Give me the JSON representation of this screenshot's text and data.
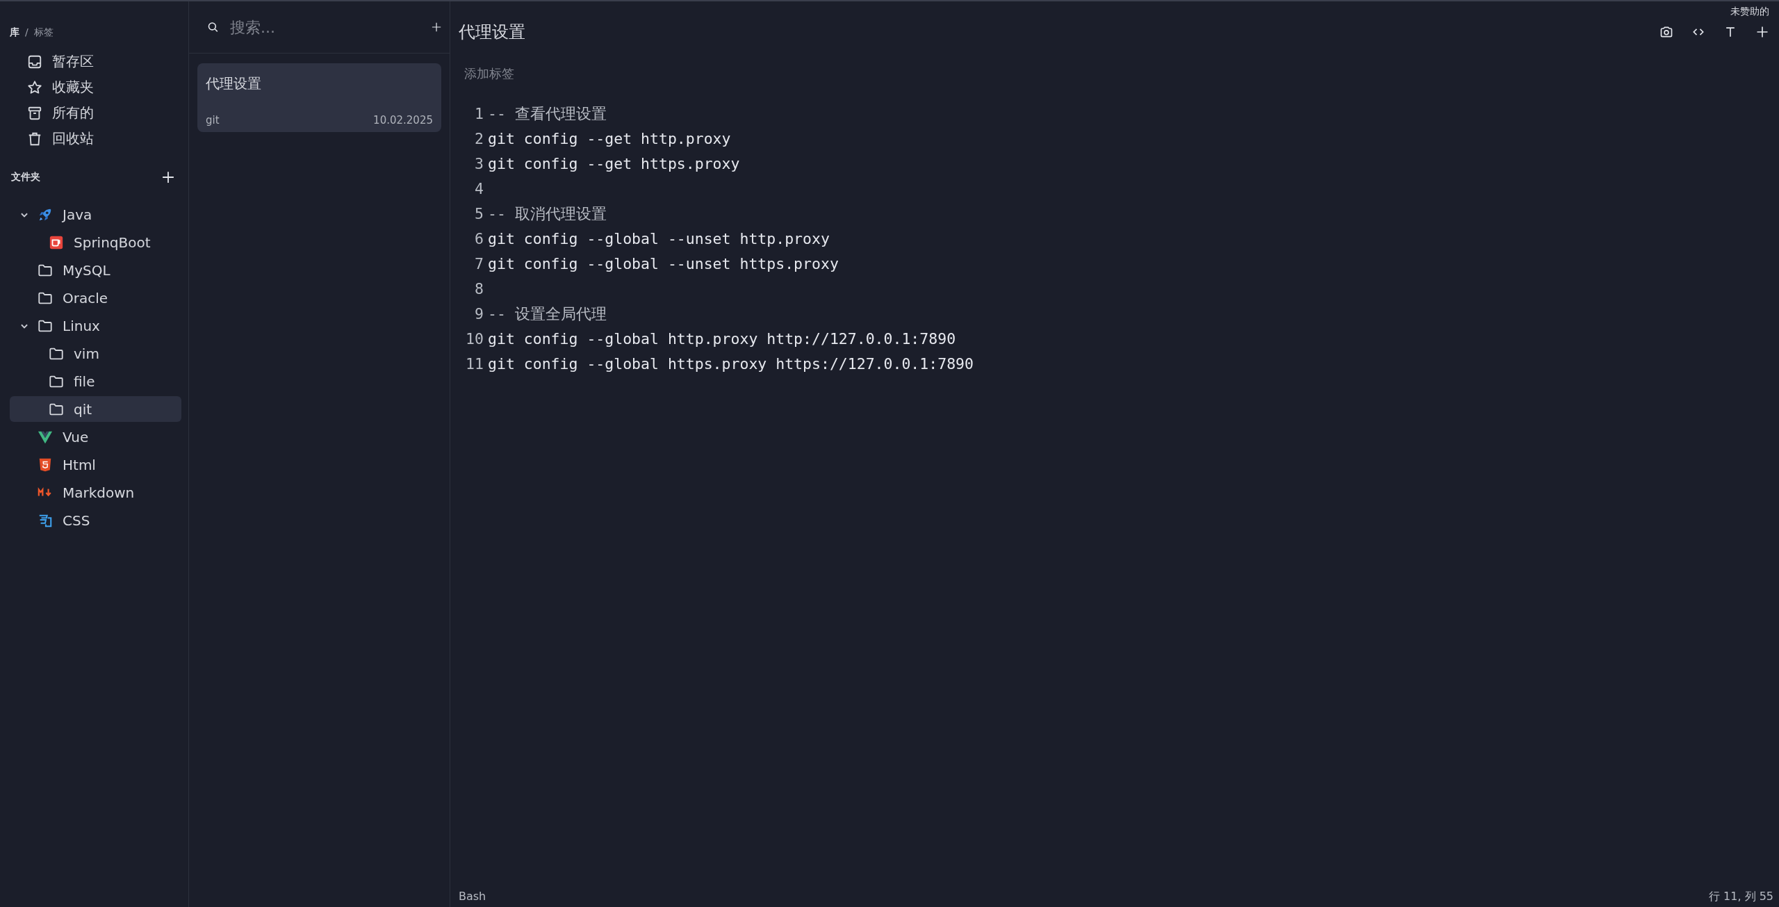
{
  "breadcrumb": {
    "library": "库",
    "separator": "/",
    "tags": "标签"
  },
  "library_items": [
    {
      "label": "暂存区",
      "kind": "inbox"
    },
    {
      "label": "收藏夹",
      "kind": "star"
    },
    {
      "label": "所有的",
      "kind": "archive"
    },
    {
      "label": "回收站",
      "kind": "trash"
    }
  ],
  "folders_heading": "文件夹",
  "folders": [
    {
      "label": "Java",
      "kind": "rocket",
      "expanded": true,
      "selected": false,
      "children": [
        {
          "label": "SprinqBoot",
          "kind": "cup",
          "selected": false
        }
      ]
    },
    {
      "label": "MySQL",
      "kind": "folder",
      "selected": false
    },
    {
      "label": "Oracle",
      "kind": "folder",
      "selected": false
    },
    {
      "label": "Linux",
      "kind": "folder",
      "expanded": true,
      "selected": false,
      "children": [
        {
          "label": "vim",
          "kind": "folder",
          "selected": false
        },
        {
          "label": "file",
          "kind": "folder",
          "selected": false
        },
        {
          "label": "qit",
          "kind": "folder",
          "selected": true
        }
      ]
    },
    {
      "label": "Vue",
      "kind": "v-logo",
      "selected": false
    },
    {
      "label": "Html",
      "kind": "shield",
      "selected": false
    },
    {
      "label": "Markdown",
      "kind": "md",
      "selected": false
    },
    {
      "label": "CSS",
      "kind": "css",
      "selected": false
    }
  ],
  "search": {
    "placeholder": "搜索..."
  },
  "notes": [
    {
      "title": "代理设置",
      "tag": "git",
      "date": "10.02.2025",
      "selected": true
    }
  ],
  "editor": {
    "title": "代理设置",
    "sponsor": "未赞助的",
    "tag_placeholder": "添加标签",
    "lines": [
      {
        "number": "1",
        "kind": "comment",
        "text": "-- 查看代理设置"
      },
      {
        "number": "2",
        "kind": "command",
        "text": "git config --get http.proxy"
      },
      {
        "number": "3",
        "kind": "command",
        "text": "git config --get https.proxy"
      },
      {
        "number": "4",
        "kind": "blank"
      },
      {
        "number": "5",
        "kind": "comment",
        "text": "-- 取消代理设置"
      },
      {
        "number": "6",
        "kind": "command",
        "text": "git config --global --unset http.proxy"
      },
      {
        "number": "7",
        "kind": "command",
        "text": "git config --global --unset https.proxy"
      },
      {
        "number": "8",
        "kind": "blank"
      },
      {
        "number": "9",
        "kind": "comment",
        "text": "-- 设置全局代理"
      },
      {
        "number": "10",
        "kind": "command",
        "text": "git config --global http.proxy http://127.0.0.1:7890"
      },
      {
        "number": "11",
        "kind": "command",
        "text": "git config --global https.proxy https://127.0.0.1:7890"
      }
    ]
  },
  "status_bar": {
    "language": "Bash",
    "cursor": "行 11, 列 55"
  }
}
